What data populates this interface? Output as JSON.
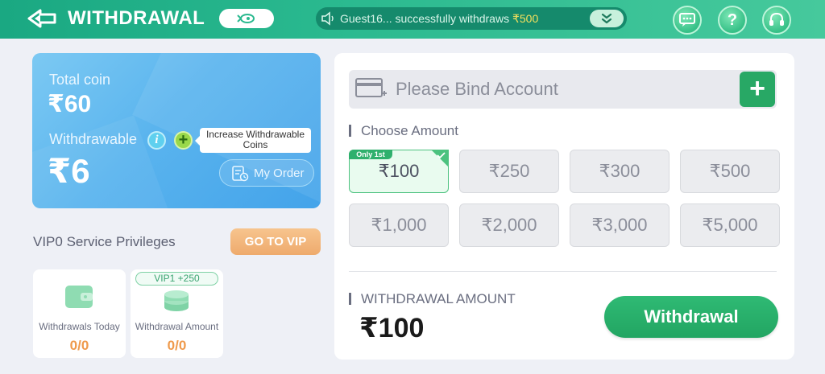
{
  "header": {
    "title": "WITHDRAWAL",
    "marquee": {
      "user": "Guest16... successfully withdraws ",
      "amount": "₹500"
    },
    "help_label": "?"
  },
  "coin_card": {
    "total_label": "Total coin",
    "total_value": "₹60",
    "withdrawable_label": "Withdrawable",
    "info_label": "i",
    "plus_label": "+",
    "tooltip": "Increase Withdrawable Coins",
    "withdrawable_value": "₹6",
    "my_order_label": "My Order"
  },
  "vip": {
    "label": "VIP0 Service Privileges",
    "button_label": "GO TO VIP",
    "cards": [
      {
        "badge": "",
        "label": "Withdrawals Today",
        "value": "0/0"
      },
      {
        "badge": "VIP1 +250",
        "label": "Withdrawal Amount",
        "value": "0/0"
      }
    ]
  },
  "panel": {
    "bind_placeholder": "Please Bind Account",
    "bind_add_label": "+",
    "choose_title": "Choose Amount",
    "only_tag": "Only 1st",
    "amounts": [
      "₹100",
      "₹250",
      "₹300",
      "₹500",
      "₹1,000",
      "₹2,000",
      "₹3,000",
      "₹5,000"
    ],
    "selected_amount": "₹100",
    "withdrawal_amount_title": "WITHDRAWAL AMOUNT",
    "withdrawal_amount_value": "₹100",
    "withdraw_button_label": "Withdrawal"
  },
  "colors": {
    "header_green": "#2ab98f",
    "accent_green": "#28a865",
    "card_blue": "#5ab4ee",
    "vip_orange": "#eeaa6c",
    "stat_orange": "#ef9a4c"
  },
  "icons": [
    "back-arrow-icon",
    "rocket-icon",
    "speaker-icon",
    "chevron-double-down-icon",
    "chat-icon",
    "help-icon",
    "headset-icon",
    "bank-card-icon",
    "wallet-icon",
    "coin-stack-icon",
    "order-icon"
  ]
}
